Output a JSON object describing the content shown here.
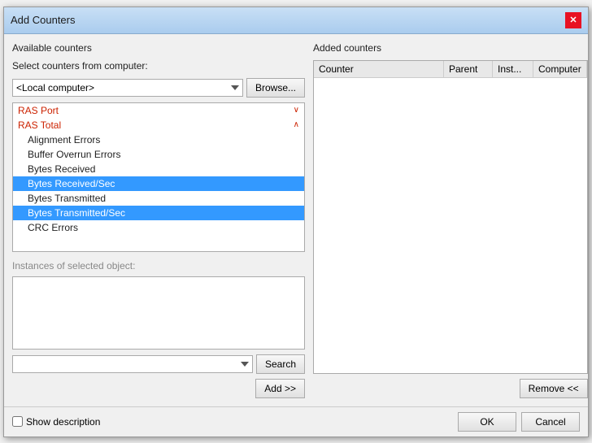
{
  "dialog": {
    "title": "Add Counters",
    "close_label": "✕"
  },
  "left": {
    "available_counters_label": "Available counters",
    "select_label": "Select counters from computer:",
    "computer_value": "<Local computer>",
    "browse_label": "Browse...",
    "counters": [
      {
        "id": "ras-port",
        "text": "RAS Port",
        "type": "parent",
        "expanded": false
      },
      {
        "id": "ras-total",
        "text": "RAS Total",
        "type": "parent",
        "expanded": true
      },
      {
        "id": "alignment-errors",
        "text": "Alignment Errors",
        "type": "child"
      },
      {
        "id": "buffer-overrun-errors",
        "text": "Buffer Overrun Errors",
        "type": "child"
      },
      {
        "id": "bytes-received",
        "text": "Bytes Received",
        "type": "child"
      },
      {
        "id": "bytes-received-sec",
        "text": "Bytes Received/Sec",
        "type": "child",
        "selected": true
      },
      {
        "id": "bytes-transmitted",
        "text": "Bytes Transmitted",
        "type": "child"
      },
      {
        "id": "bytes-transmitted-sec",
        "text": "Bytes Transmitted/Sec",
        "type": "child",
        "selected": true
      },
      {
        "id": "crc-errors",
        "text": "CRC Errors",
        "type": "child"
      }
    ],
    "instances_label": "Instances of selected object:",
    "search_placeholder": "",
    "search_label": "Search",
    "add_label": "Add >>"
  },
  "right": {
    "added_counters_label": "Added counters",
    "columns": [
      "Counter",
      "Parent",
      "Inst...",
      "Computer"
    ],
    "remove_label": "Remove <<"
  },
  "bottom": {
    "show_description_label": "Show description",
    "ok_label": "OK",
    "cancel_label": "Cancel"
  }
}
